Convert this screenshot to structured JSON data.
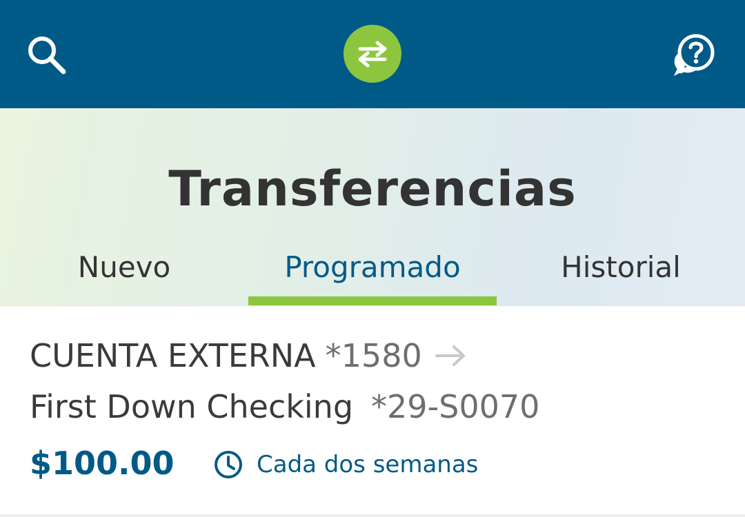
{
  "header": {
    "search_icon": "search-icon",
    "transfer_icon": "transfer-arrows-icon",
    "help_icon": "help-chat-icon",
    "colors": {
      "bar": "#005a87",
      "accent": "#8cc63f"
    }
  },
  "page": {
    "title": "Transferencias"
  },
  "tabs": [
    {
      "label": "Nuevo",
      "active": false
    },
    {
      "label": "Programado",
      "active": true
    },
    {
      "label": "Historial",
      "active": false
    }
  ],
  "transfers": [
    {
      "from_name": "CUENTA EXTERNA",
      "from_number": "*1580",
      "arrow_icon": "arrow-right-icon",
      "to_name": "First Down Checking",
      "to_number": "*29-S0070",
      "amount": "$100.00",
      "frequency_icon": "clock-icon",
      "frequency": "Cada dos semanas"
    }
  ]
}
